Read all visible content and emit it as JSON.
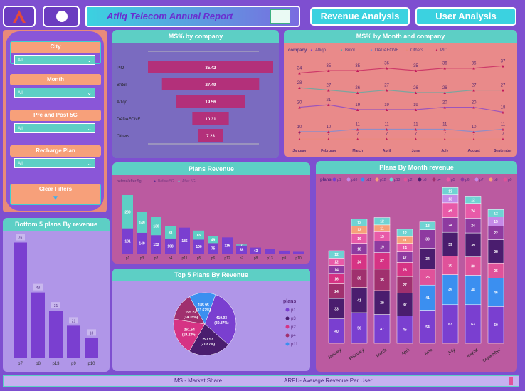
{
  "header": {
    "title": "Atliq  Telecom Annual Report",
    "revenue_btn": "Revenue Analysis",
    "user_btn": "User Analysis"
  },
  "filters": {
    "city_label": "City",
    "city_value": "All",
    "month_label": "Month",
    "month_value": "All",
    "prepost_label": "Pre and Post 5G",
    "prepost_value": "All",
    "plan_label": "Recharge Plan",
    "plan_value": "All",
    "clear_label": "Clear Filters"
  },
  "footer": {
    "ms_note": "MS - Market Share",
    "arpu_note": "ARPU- Average Revenue Per User"
  },
  "colors": {
    "teal": "#5dcfc5",
    "purple": "#7e4fd0",
    "salmon": "#f7a07a",
    "pink_panel": "#bb5aa0"
  },
  "chart_data": [
    {
      "id": "ms_company",
      "type": "bar",
      "title": "MS% by company",
      "categories": [
        "PIO",
        "Britol",
        "Atliqo",
        "DADAFONE",
        "Others"
      ],
      "values": [
        35.42,
        27.49,
        19.56,
        10.31,
        7.23
      ]
    },
    {
      "id": "ms_month",
      "type": "line",
      "title": "MS% by Month and company",
      "legend_title": "company",
      "categories": [
        "January",
        "February",
        "March",
        "April",
        "June",
        "July",
        "August",
        "September"
      ],
      "series": [
        {
          "name": "Atliqo",
          "color": "#7a3fd0",
          "values": [
            20,
            21,
            19,
            19,
            19,
            20,
            20,
            18
          ]
        },
        {
          "name": "Britol",
          "color": "#4ab0a8",
          "values": [
            28,
            27,
            26,
            27,
            26,
            26,
            27,
            27
          ]
        },
        {
          "name": "DADAFONE",
          "color": "#6b8fe0",
          "values": [
            10,
            10,
            11,
            11,
            11,
            11,
            10,
            11
          ]
        },
        {
          "name": "Others",
          "color": "#e98a7a",
          "values": [
            7,
            7,
            7,
            7,
            7,
            7,
            7,
            7
          ]
        },
        {
          "name": "PIO",
          "color": "#c2185b",
          "values": [
            34,
            35,
            35,
            36,
            35,
            36,
            36,
            37
          ]
        }
      ]
    },
    {
      "id": "plans_revenue",
      "type": "bar",
      "title": "Plans Revenue",
      "legend_title": "before/after 5g",
      "series_names": [
        "Before 5G",
        "After 5G"
      ],
      "categories": [
        "p1",
        "p3",
        "p2",
        "p4",
        "p11",
        "p5",
        "p6",
        "p12",
        "p7",
        "p8",
        "p13",
        "p9",
        "p10"
      ],
      "series": [
        {
          "name": "Before 5G",
          "values": [
            181,
            149,
            132,
            108,
            186,
            100,
            75,
            116,
            58,
            43,
            31,
            21,
            13
          ]
        },
        {
          "name": "After 5G",
          "values": [
            239,
            149,
            130,
            88,
            0,
            65,
            49,
            0,
            7,
            0,
            0,
            0,
            0
          ]
        }
      ],
      "labels": [
        [
          "181",
          "239"
        ],
        [
          "149",
          "149"
        ],
        [
          "132",
          "130"
        ],
        [
          "108",
          "88"
        ],
        [
          "186",
          ""
        ],
        [
          "100",
          "65"
        ],
        [
          "75",
          "49"
        ],
        [
          "116",
          ""
        ],
        [
          "58",
          "7"
        ],
        [
          "43",
          ""
        ],
        [
          "",
          ""
        ],
        [
          "",
          ""
        ],
        [
          "",
          ""
        ]
      ]
    },
    {
      "id": "bottom5",
      "type": "bar",
      "title": "Bottom 5 plans By revenue",
      "categories": [
        "p7",
        "p8",
        "p13",
        "p9",
        "p10"
      ],
      "values": [
        76,
        43,
        31,
        21,
        13
      ]
    },
    {
      "id": "top5",
      "type": "pie",
      "title": "Top 5 Plans By Revenue",
      "legend_title": "plans",
      "slices": [
        {
          "name": "p1",
          "value": 419.93,
          "label": "419.93 (30.87%)",
          "color": "#7a3fd0"
        },
        {
          "name": "p3",
          "value": 297.53,
          "label": "297.53 (21.87%)",
          "color": "#4a1d6e"
        },
        {
          "name": "p2",
          "value": 261.54,
          "label": "261.54 (19.23%)",
          "color": "#d63384"
        },
        {
          "name": "p4",
          "value": 195.22,
          "label": "195.22 (14.35%)",
          "color": "#a0306e"
        },
        {
          "name": "p11",
          "value": 185.95,
          "label": "185.95 (13.67%)",
          "color": "#3b8ff0"
        }
      ]
    },
    {
      "id": "plans_month",
      "type": "bar",
      "title": "Plans By Month revenue",
      "legend_title": "plans",
      "categories": [
        "January",
        "February",
        "March",
        "April",
        "June",
        "July",
        "August",
        "September"
      ],
      "legend_names": [
        "p1",
        "p10",
        "p11",
        "p12",
        "p13",
        "p2",
        "p3",
        "p4",
        "p5",
        "p6",
        "p7",
        "p8",
        "p9"
      ],
      "series": [
        {
          "name": "p1",
          "color": "#7a3fd0",
          "values": [
            40,
            50,
            47,
            45,
            54,
            63,
            63,
            60
          ]
        },
        {
          "name": "p11",
          "color": "#3b8ff0",
          "values": [
            0,
            0,
            0,
            0,
            41,
            49,
            48,
            46
          ]
        },
        {
          "name": "p3",
          "color": "#4a1d6e",
          "values": [
            33,
            41,
            39,
            37,
            0,
            0,
            0,
            0
          ]
        },
        {
          "name": "p2",
          "color": "#e0529a",
          "values": [
            0,
            0,
            0,
            0,
            26,
            30,
            30,
            25
          ]
        },
        {
          "name": "p4",
          "color": "#a0306e",
          "values": [
            24,
            30,
            35,
            27,
            0,
            0,
            0,
            0
          ]
        },
        {
          "name": "p2b",
          "color": "#d63384",
          "values": [
            16,
            24,
            27,
            23,
            0,
            0,
            0,
            0
          ]
        },
        {
          "name": "p3b",
          "color": "#4a1d6e",
          "values": [
            0,
            0,
            0,
            0,
            34,
            39,
            39,
            38
          ]
        },
        {
          "name": "p6",
          "color": "#8e3aa0",
          "values": [
            14,
            18,
            19,
            17,
            30,
            24,
            24,
            22
          ]
        },
        {
          "name": "p5",
          "color": "#e85aa8",
          "values": [
            12,
            16,
            15,
            14,
            0,
            24,
            24,
            0
          ]
        },
        {
          "name": "p7",
          "color": "#c58ae8",
          "values": [
            0,
            0,
            0,
            0,
            0,
            13,
            0,
            15
          ]
        },
        {
          "name": "p12",
          "color": "#f7a07a",
          "values": [
            0,
            12,
            11,
            11,
            0,
            0,
            0,
            0
          ]
        },
        {
          "name": "p13",
          "color": "#6fd3d3",
          "values": [
            12,
            12,
            12,
            12,
            13,
            12,
            12,
            12
          ]
        },
        {
          "name": "p10",
          "color": "#c58ae8",
          "values": [
            0,
            0,
            0,
            0,
            0,
            0,
            0,
            0
          ]
        }
      ]
    }
  ]
}
